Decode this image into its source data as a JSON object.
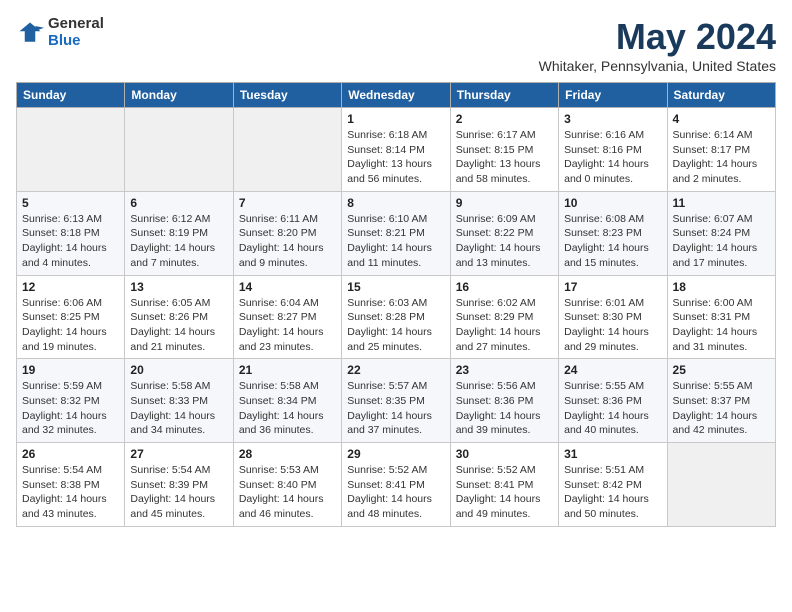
{
  "logo": {
    "general": "General",
    "blue": "Blue"
  },
  "header": {
    "month": "May 2024",
    "location": "Whitaker, Pennsylvania, United States"
  },
  "weekdays": [
    "Sunday",
    "Monday",
    "Tuesday",
    "Wednesday",
    "Thursday",
    "Friday",
    "Saturday"
  ],
  "weeks": [
    [
      {
        "day": "",
        "info": ""
      },
      {
        "day": "",
        "info": ""
      },
      {
        "day": "",
        "info": ""
      },
      {
        "day": "1",
        "info": "Sunrise: 6:18 AM\nSunset: 8:14 PM\nDaylight: 13 hours\nand 56 minutes."
      },
      {
        "day": "2",
        "info": "Sunrise: 6:17 AM\nSunset: 8:15 PM\nDaylight: 13 hours\nand 58 minutes."
      },
      {
        "day": "3",
        "info": "Sunrise: 6:16 AM\nSunset: 8:16 PM\nDaylight: 14 hours\nand 0 minutes."
      },
      {
        "day": "4",
        "info": "Sunrise: 6:14 AM\nSunset: 8:17 PM\nDaylight: 14 hours\nand 2 minutes."
      }
    ],
    [
      {
        "day": "5",
        "info": "Sunrise: 6:13 AM\nSunset: 8:18 PM\nDaylight: 14 hours\nand 4 minutes."
      },
      {
        "day": "6",
        "info": "Sunrise: 6:12 AM\nSunset: 8:19 PM\nDaylight: 14 hours\nand 7 minutes."
      },
      {
        "day": "7",
        "info": "Sunrise: 6:11 AM\nSunset: 8:20 PM\nDaylight: 14 hours\nand 9 minutes."
      },
      {
        "day": "8",
        "info": "Sunrise: 6:10 AM\nSunset: 8:21 PM\nDaylight: 14 hours\nand 11 minutes."
      },
      {
        "day": "9",
        "info": "Sunrise: 6:09 AM\nSunset: 8:22 PM\nDaylight: 14 hours\nand 13 minutes."
      },
      {
        "day": "10",
        "info": "Sunrise: 6:08 AM\nSunset: 8:23 PM\nDaylight: 14 hours\nand 15 minutes."
      },
      {
        "day": "11",
        "info": "Sunrise: 6:07 AM\nSunset: 8:24 PM\nDaylight: 14 hours\nand 17 minutes."
      }
    ],
    [
      {
        "day": "12",
        "info": "Sunrise: 6:06 AM\nSunset: 8:25 PM\nDaylight: 14 hours\nand 19 minutes."
      },
      {
        "day": "13",
        "info": "Sunrise: 6:05 AM\nSunset: 8:26 PM\nDaylight: 14 hours\nand 21 minutes."
      },
      {
        "day": "14",
        "info": "Sunrise: 6:04 AM\nSunset: 8:27 PM\nDaylight: 14 hours\nand 23 minutes."
      },
      {
        "day": "15",
        "info": "Sunrise: 6:03 AM\nSunset: 8:28 PM\nDaylight: 14 hours\nand 25 minutes."
      },
      {
        "day": "16",
        "info": "Sunrise: 6:02 AM\nSunset: 8:29 PM\nDaylight: 14 hours\nand 27 minutes."
      },
      {
        "day": "17",
        "info": "Sunrise: 6:01 AM\nSunset: 8:30 PM\nDaylight: 14 hours\nand 29 minutes."
      },
      {
        "day": "18",
        "info": "Sunrise: 6:00 AM\nSunset: 8:31 PM\nDaylight: 14 hours\nand 31 minutes."
      }
    ],
    [
      {
        "day": "19",
        "info": "Sunrise: 5:59 AM\nSunset: 8:32 PM\nDaylight: 14 hours\nand 32 minutes."
      },
      {
        "day": "20",
        "info": "Sunrise: 5:58 AM\nSunset: 8:33 PM\nDaylight: 14 hours\nand 34 minutes."
      },
      {
        "day": "21",
        "info": "Sunrise: 5:58 AM\nSunset: 8:34 PM\nDaylight: 14 hours\nand 36 minutes."
      },
      {
        "day": "22",
        "info": "Sunrise: 5:57 AM\nSunset: 8:35 PM\nDaylight: 14 hours\nand 37 minutes."
      },
      {
        "day": "23",
        "info": "Sunrise: 5:56 AM\nSunset: 8:36 PM\nDaylight: 14 hours\nand 39 minutes."
      },
      {
        "day": "24",
        "info": "Sunrise: 5:55 AM\nSunset: 8:36 PM\nDaylight: 14 hours\nand 40 minutes."
      },
      {
        "day": "25",
        "info": "Sunrise: 5:55 AM\nSunset: 8:37 PM\nDaylight: 14 hours\nand 42 minutes."
      }
    ],
    [
      {
        "day": "26",
        "info": "Sunrise: 5:54 AM\nSunset: 8:38 PM\nDaylight: 14 hours\nand 43 minutes."
      },
      {
        "day": "27",
        "info": "Sunrise: 5:54 AM\nSunset: 8:39 PM\nDaylight: 14 hours\nand 45 minutes."
      },
      {
        "day": "28",
        "info": "Sunrise: 5:53 AM\nSunset: 8:40 PM\nDaylight: 14 hours\nand 46 minutes."
      },
      {
        "day": "29",
        "info": "Sunrise: 5:52 AM\nSunset: 8:41 PM\nDaylight: 14 hours\nand 48 minutes."
      },
      {
        "day": "30",
        "info": "Sunrise: 5:52 AM\nSunset: 8:41 PM\nDaylight: 14 hours\nand 49 minutes."
      },
      {
        "day": "31",
        "info": "Sunrise: 5:51 AM\nSunset: 8:42 PM\nDaylight: 14 hours\nand 50 minutes."
      },
      {
        "day": "",
        "info": ""
      }
    ]
  ]
}
